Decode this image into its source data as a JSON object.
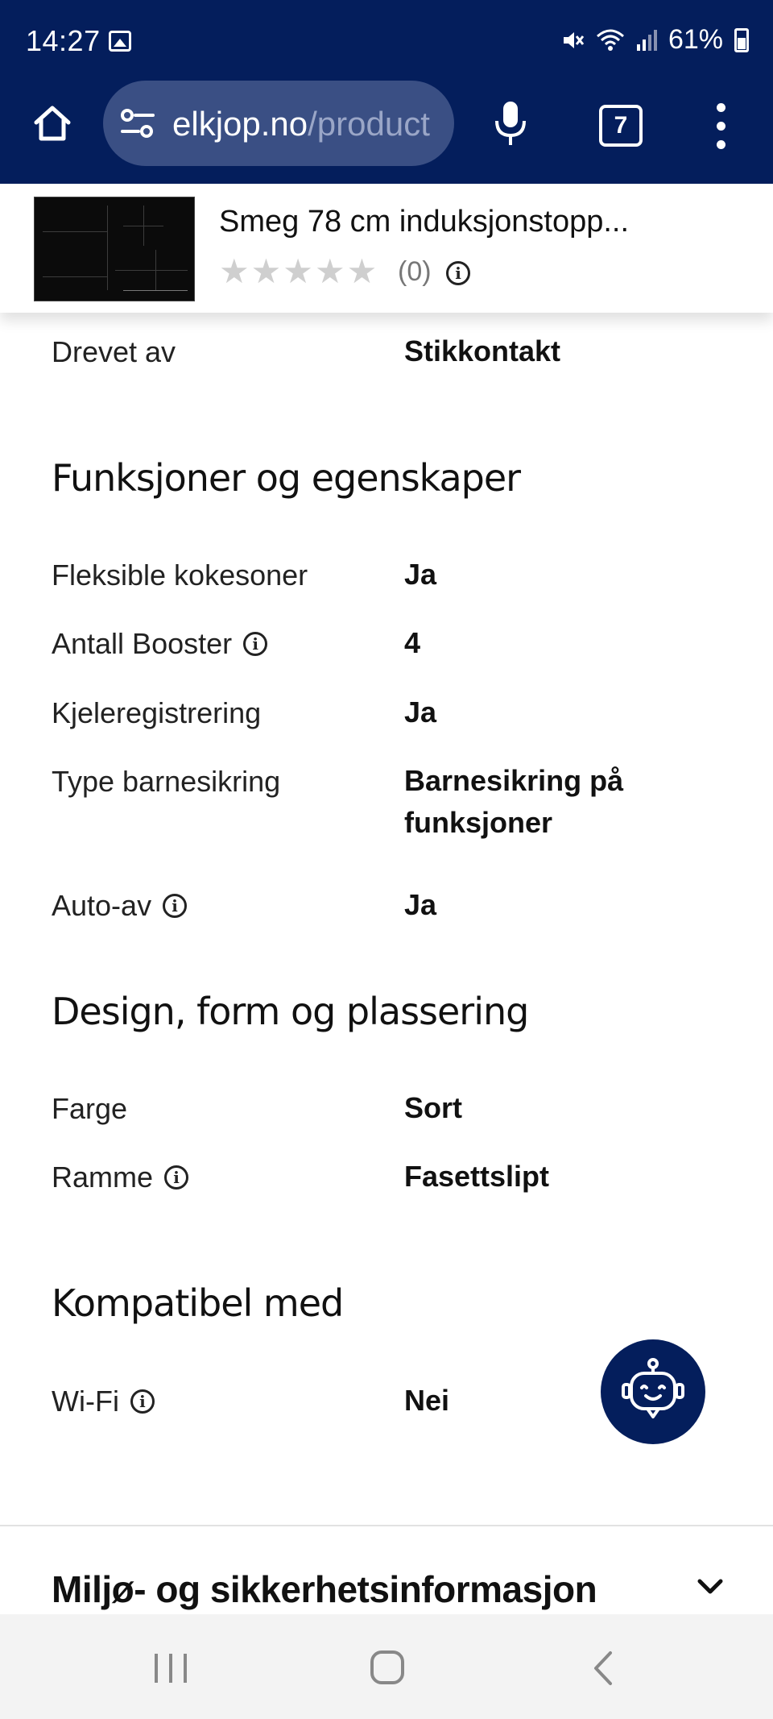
{
  "status_bar": {
    "time": "14:27",
    "battery": "61%"
  },
  "browser": {
    "url_host": "elkjop.no",
    "url_path": "/product",
    "tab_count": "7"
  },
  "product_header": {
    "title": "Smeg 78 cm induksjonstopp...",
    "stars": "★★★★★",
    "rating_count": "(0)"
  },
  "top_row": {
    "label": "Drevet av",
    "value": "Stikkontakt"
  },
  "sections": [
    {
      "heading": "Funksjoner og egenskaper",
      "rows": [
        {
          "label": "Fleksible kokesoner",
          "value": "Ja"
        },
        {
          "label": "Antall Booster",
          "value": "4"
        },
        {
          "label": "Kjeleregistrering",
          "value": "Ja"
        },
        {
          "label": "Type barnesikring",
          "value": "Barnesikring på funksjoner"
        },
        {
          "label": "Auto-av",
          "value": "Ja"
        }
      ]
    },
    {
      "heading": "Design, form og plassering",
      "rows": [
        {
          "label": "Farge",
          "value": "Sort"
        },
        {
          "label": "Ramme",
          "value": "Fasettslipt"
        }
      ]
    },
    {
      "heading": "Kompatibel med",
      "rows": [
        {
          "label": "Wi-Fi",
          "value": "Nei"
        }
      ]
    }
  ],
  "env_section": {
    "heading": "Miljø- og sikkerhetsinformasjon"
  },
  "colors": {
    "brand_navy": "#041e5c",
    "url_bar": "#3a4f84",
    "star_gray": "#cfcfcf"
  }
}
